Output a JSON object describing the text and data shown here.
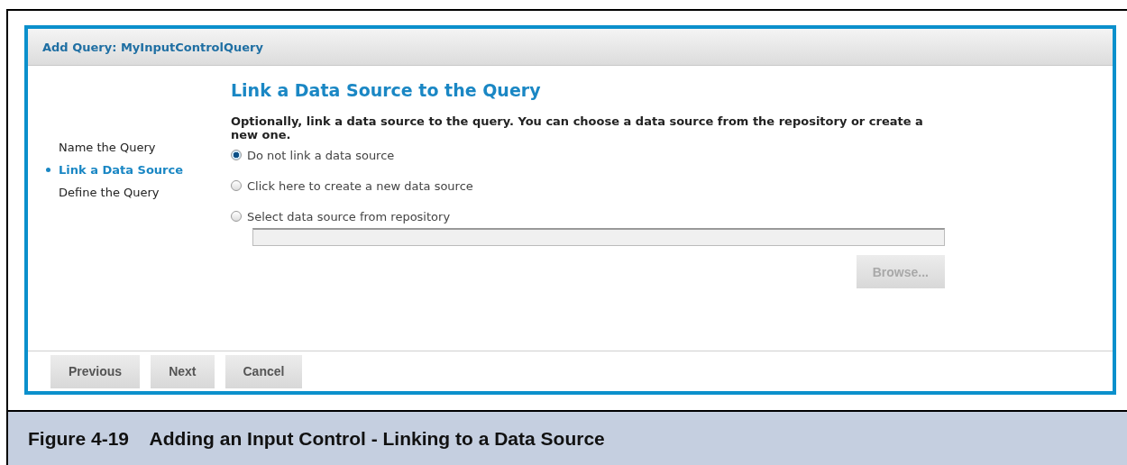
{
  "dialog": {
    "title": "Add Query: MyInputControlQuery"
  },
  "steps": [
    {
      "label": "Name the Query",
      "selected": false
    },
    {
      "label": "Link a Data Source",
      "selected": true
    },
    {
      "label": "Define the Query",
      "selected": false
    }
  ],
  "heading": "Link a Data Source to the Query",
  "instructions": "Optionally, link a data source to the query. You can choose a data source from the repository or create a new one.",
  "options": [
    {
      "label": "Do not link a data source",
      "selected": true
    },
    {
      "label": "Click here to create a new data source",
      "selected": false
    },
    {
      "label": "Select data source from repository",
      "selected": false
    }
  ],
  "repository_field": {
    "disabled": true
  },
  "browse_button": {
    "label": "Browse...",
    "disabled": true
  },
  "footer_buttons": [
    {
      "label": "Previous"
    },
    {
      "label": "Next"
    },
    {
      "label": "Cancel"
    }
  ],
  "caption": "Figure 4-19    Adding an Input Control - Linking to a Data Source"
}
